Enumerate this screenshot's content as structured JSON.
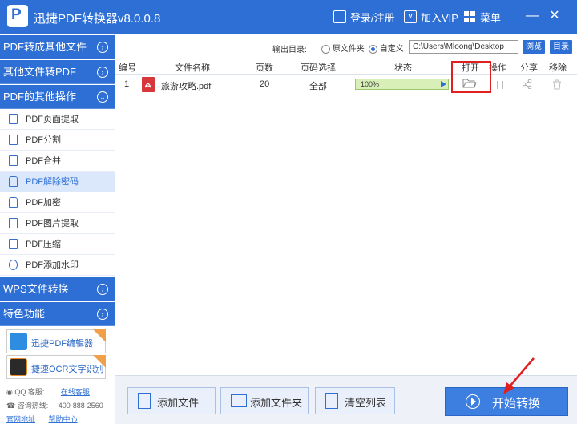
{
  "titlebar": {
    "title": "迅捷PDF转换器v8.0.0.8",
    "login": "登录/注册",
    "vip": "加入VIP",
    "menu": "菜单",
    "minimize": "—",
    "close": "✕"
  },
  "sidebar": {
    "categories": [
      {
        "label": "PDF转成其他文件"
      },
      {
        "label": "其他文件转PDF"
      },
      {
        "label": "PDF的其他操作"
      },
      {
        "label": "WPS文件转换"
      },
      {
        "label": "特色功能"
      }
    ],
    "sub_items": [
      {
        "label": "PDF页面提取",
        "icon": "page-extract-icon"
      },
      {
        "label": "PDF分割",
        "icon": "split-icon"
      },
      {
        "label": "PDF合并",
        "icon": "merge-icon"
      },
      {
        "label": "PDF解除密码",
        "icon": "unlock-icon"
      },
      {
        "label": "PDF加密",
        "icon": "lock-icon"
      },
      {
        "label": "PDF图片提取",
        "icon": "image-extract-icon"
      },
      {
        "label": "PDF压缩",
        "icon": "compress-icon"
      },
      {
        "label": "PDF添加水印",
        "icon": "watermark-icon"
      }
    ],
    "promos": [
      {
        "label": "迅捷PDF编辑器",
        "badge": "NEW"
      },
      {
        "label": "捷速OCR文字识别",
        "badge": "NEW"
      }
    ],
    "contact": {
      "qq_label": "QQ 客服:",
      "qq_link": "在线客服",
      "phone_label": "咨询热线:",
      "phone": "400-888-2560",
      "site_label": "官网地址",
      "help_label": "帮助中心"
    }
  },
  "output": {
    "label": "输出目录:",
    "option_original": "原文件夹",
    "option_custom": "自定义",
    "path": "C:\\Users\\Mloong\\Desktop",
    "browse": "浏览",
    "dir": "目录"
  },
  "table": {
    "headers": [
      "编号",
      "文件名称",
      "页数",
      "页码选择",
      "状态",
      "打开",
      "操作",
      "分享",
      "移除"
    ],
    "rows": [
      {
        "index": "1",
        "name": "旅游攻略.pdf",
        "pages": "20",
        "page_select": "全部",
        "status": "100%",
        "progress": 1.0
      }
    ]
  },
  "bottom": {
    "add_file": "添加文件",
    "add_folder": "添加文件夹",
    "clear_list": "清空列表",
    "start": "开始转换"
  },
  "colors": {
    "brand": "#2e6fd5",
    "highlight": "#e02020",
    "pdf_red": "#d7363b"
  }
}
